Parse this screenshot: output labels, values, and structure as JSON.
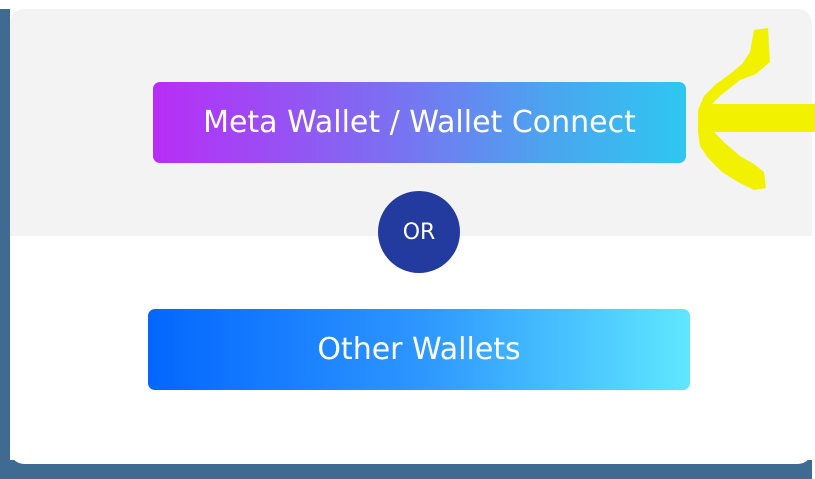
{
  "connect_modal": {
    "primary_button_label": "Meta Wallet / Wallet Connect",
    "divider_label": "OR",
    "secondary_button_label": "Other Wallets"
  },
  "annotation": {
    "icon": "arrow-left-icon",
    "color": "#f2f200"
  },
  "colors": {
    "backdrop": "#3f6a92",
    "card_top": "#f3f3f3",
    "or_badge": "#233b9e"
  }
}
